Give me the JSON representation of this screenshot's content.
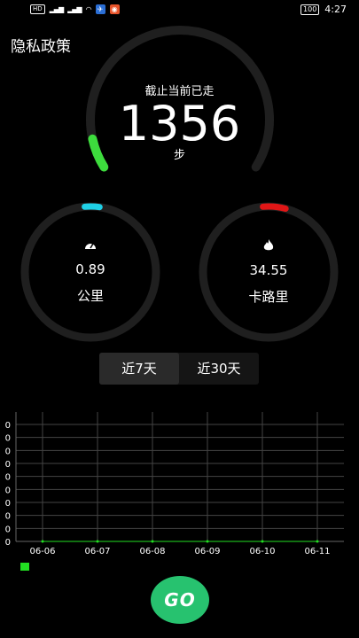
{
  "status_bar": {
    "hd_label": "HD",
    "signal_1": "³ᴳ",
    "signal_2": "⁴ᴳ",
    "battery": "100",
    "time": "4:27"
  },
  "header": {
    "privacy_link": "隐私政策"
  },
  "gauge": {
    "caption": "截止当前已走",
    "steps": "1356",
    "unit": "步",
    "progress_fraction": 0.08,
    "accent_color": "#3ddc3d"
  },
  "stats": {
    "distance": {
      "value": "0.89",
      "label": "公里",
      "icon": "speedometer-icon",
      "accent_color": "#1fd0e6"
    },
    "calories": {
      "value": "34.55",
      "label": "卡路里",
      "icon": "flame-icon",
      "accent_color": "#e01616"
    }
  },
  "range_toggle": {
    "week_label": "近7天",
    "month_label": "近30天",
    "active": "week"
  },
  "chart_data": {
    "type": "line",
    "x": [
      "06-06",
      "06-07",
      "06-08",
      "06-09",
      "06-10",
      "06-11"
    ],
    "series": [
      {
        "values": [
          0,
          0,
          0,
          0,
          0,
          0
        ],
        "color": "#22e022"
      }
    ],
    "y_tick_labels": [
      "0",
      "0",
      "0",
      "0",
      "0",
      "0",
      "0",
      "0",
      "0",
      "0"
    ],
    "grid": true,
    "legend": "bottom-left"
  },
  "go_button": {
    "label": "GO",
    "color": "#27c26f"
  }
}
